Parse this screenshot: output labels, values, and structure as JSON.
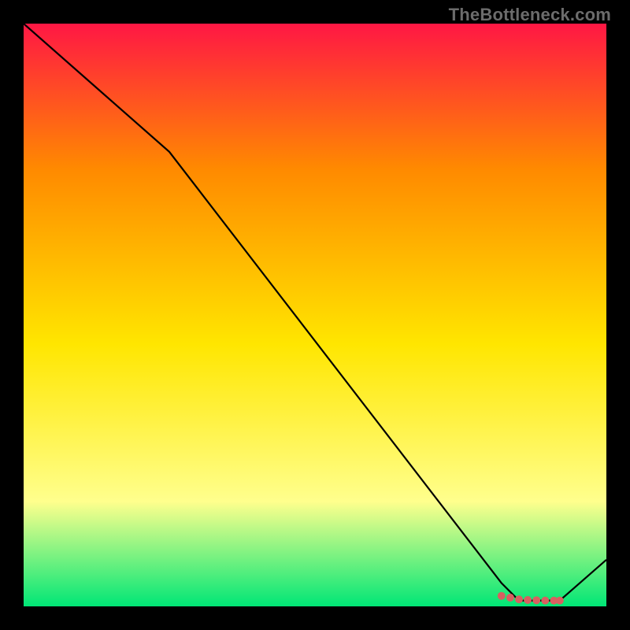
{
  "watermark": "TheBottleneck.com",
  "colors": {
    "gradient_top": "#ff1744",
    "gradient_upper_mid": "#ff8a00",
    "gradient_mid": "#ffe600",
    "gradient_lower_mid": "#ffff8d",
    "gradient_bottom": "#00e676",
    "line": "#000000",
    "marker": "#d86060",
    "frame": "#000000"
  },
  "chart_data": {
    "type": "line",
    "title": "",
    "xlabel": "",
    "ylabel": "",
    "xlim": [
      0,
      100
    ],
    "ylim": [
      0,
      100
    ],
    "series": [
      {
        "name": "curve",
        "x": [
          0,
          25,
          82,
          85,
          90,
          92,
          100
        ],
        "values": [
          100,
          78,
          4,
          1,
          1,
          1,
          8
        ]
      }
    ],
    "markers": {
      "name": "highlight-points",
      "x": [
        82,
        83.5,
        85,
        86.5,
        88,
        89.5,
        91,
        92
      ],
      "values": [
        1.8,
        1.5,
        1.2,
        1.1,
        1.05,
        1.0,
        1.0,
        1.0
      ]
    }
  }
}
